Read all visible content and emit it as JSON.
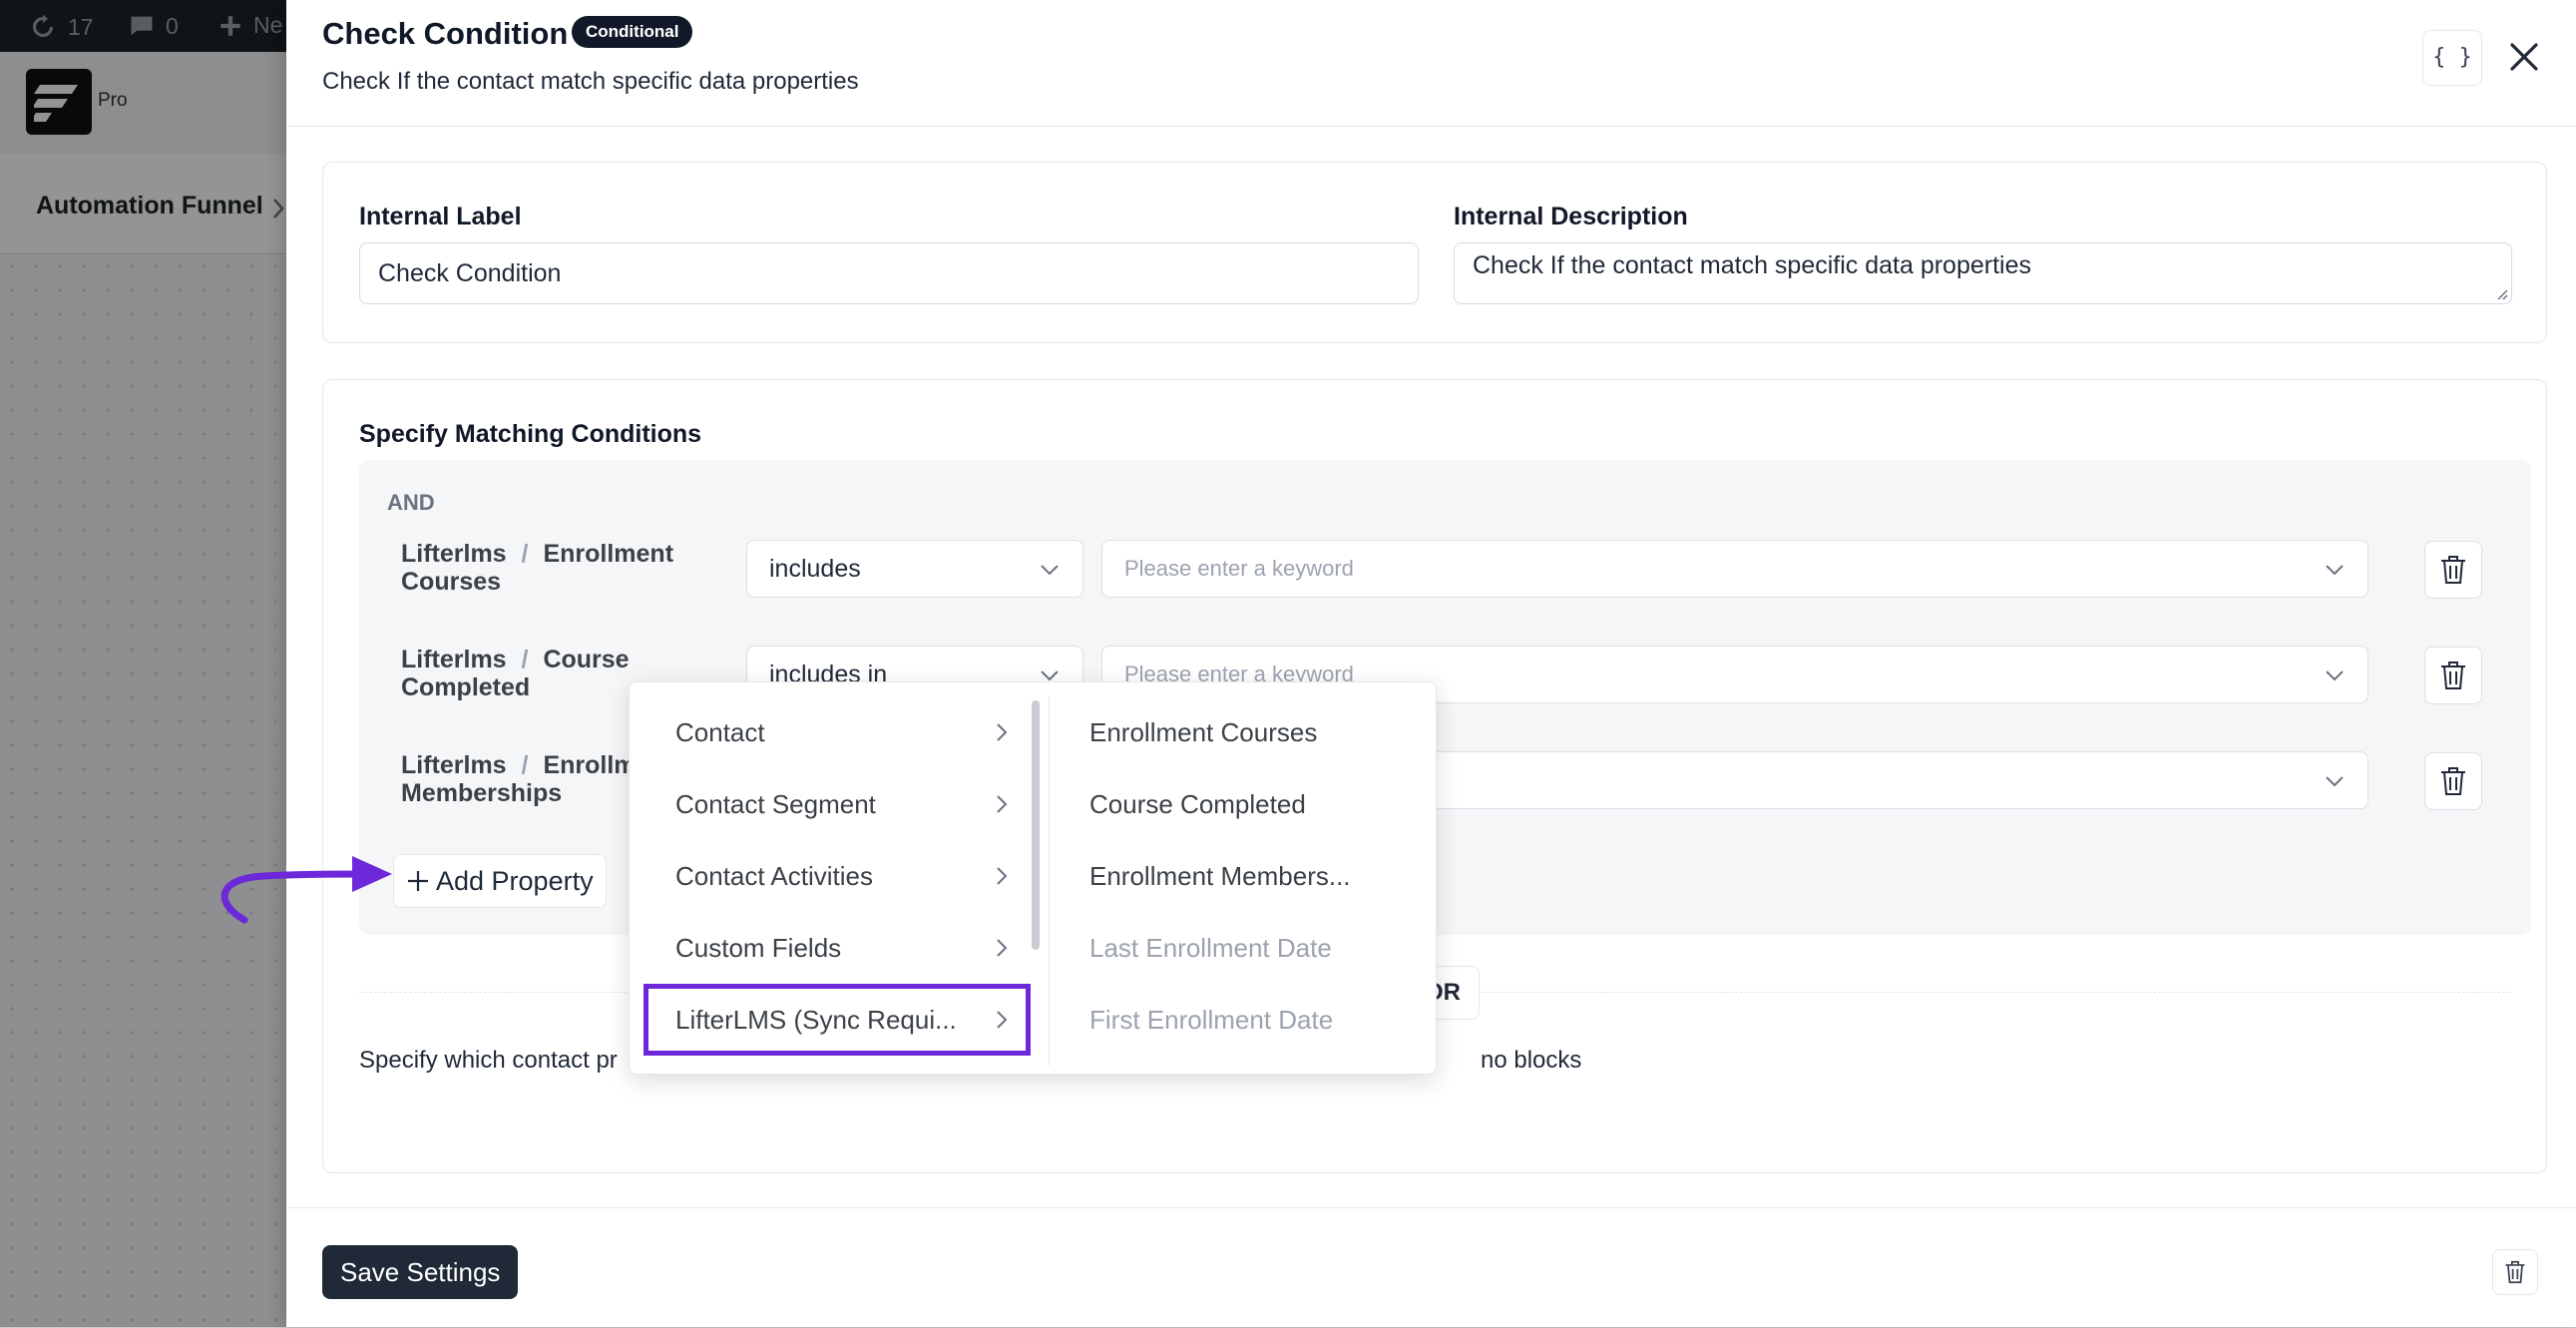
{
  "wpbar": {
    "updates_count": "17",
    "comments_count": "0",
    "new_label": "Ne"
  },
  "app": {
    "pro_label": "Pro",
    "breadcrumb": "Automation Funnel"
  },
  "drawer": {
    "title": "Check Condition",
    "badge": "Conditional",
    "subtitle": "Check If the contact match specific data properties",
    "code_button_label": "{ }"
  },
  "form": {
    "internal_label": {
      "label": "Internal Label",
      "value": "Check Condition"
    },
    "internal_description": {
      "label": "Internal Description",
      "value": "Check If the contact match specific data properties"
    }
  },
  "conditions": {
    "heading": "Specify Matching Conditions",
    "group_label": "AND",
    "rows": [
      {
        "provider": "Lifterlms",
        "sep": "/",
        "field_line1": "Enrollment",
        "field_line2": "Courses",
        "operator": "includes",
        "value_placeholder": "Please enter a keyword"
      },
      {
        "provider": "Lifterlms",
        "sep": "/",
        "field_line1": "Course",
        "field_line2": "Completed",
        "operator": "includes in",
        "value_placeholder": "Please enter a keyword"
      },
      {
        "provider": "Lifterlms",
        "sep": "/",
        "field_line1": "Enrollm",
        "field_line2": "Memberships",
        "operator": "",
        "value_placeholder": ""
      }
    ],
    "add_property": "Add Property",
    "or_label": "OR",
    "help_left": "Specify which contact pr",
    "help_right": "no blocks"
  },
  "popup": {
    "categories": [
      {
        "label": "Contact"
      },
      {
        "label": "Contact Segment"
      },
      {
        "label": "Contact Activities"
      },
      {
        "label": "Custom Fields"
      },
      {
        "label": "LifterLMS (Sync Requi...",
        "active": true
      }
    ],
    "options": [
      {
        "label": "Enrollment Courses",
        "disabled": false
      },
      {
        "label": "Course Completed",
        "disabled": false
      },
      {
        "label": "Enrollment Members...",
        "disabled": false
      },
      {
        "label": "Last Enrollment Date",
        "disabled": true
      },
      {
        "label": "First Enrollment Date",
        "disabled": true
      }
    ],
    "highlight_color": "#6d28d9"
  },
  "footer": {
    "save_label": "Save Settings"
  },
  "colors": {
    "accent": "#6d28d9",
    "dark": "#1f2937"
  }
}
